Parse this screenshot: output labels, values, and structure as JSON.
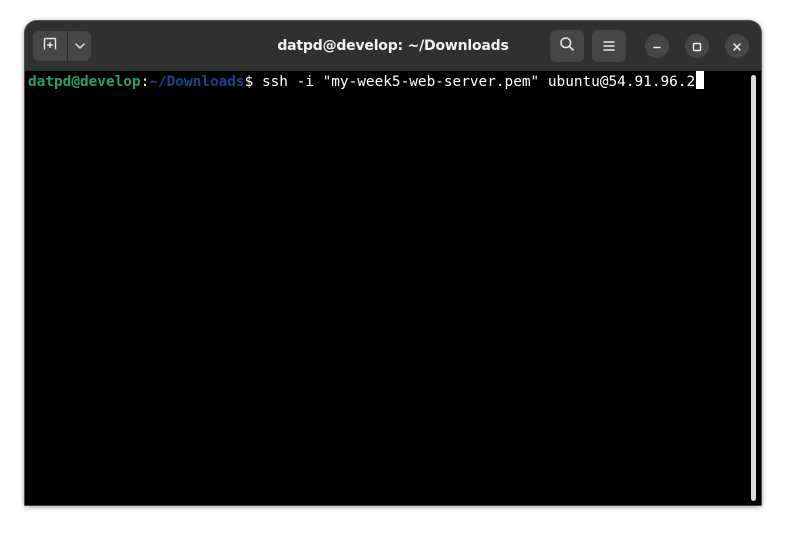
{
  "window": {
    "title": "datpd@develop: ~/Downloads"
  },
  "headerbar": {
    "new_tab_icon": "new-tab-icon",
    "menu_arrow_icon": "chevron-down-icon",
    "search_icon": "search-icon",
    "hamburger_icon": "hamburger-menu-icon",
    "minimize_icon": "minimize-icon",
    "maximize_icon": "maximize-icon",
    "close_icon": "close-icon"
  },
  "terminal": {
    "prompt_user": "datpd@develop",
    "prompt_colon": ":",
    "prompt_path": "~/Downloads",
    "prompt_dollar": "$ ",
    "command": "ssh -i \"my-week5-web-server.pem\" ubuntu@54.91.96.2"
  },
  "colors": {
    "prompt_user": "#26a269",
    "prompt_path": "#12488b",
    "terminal_bg": "#000000",
    "headerbar_bg": "#303030"
  }
}
